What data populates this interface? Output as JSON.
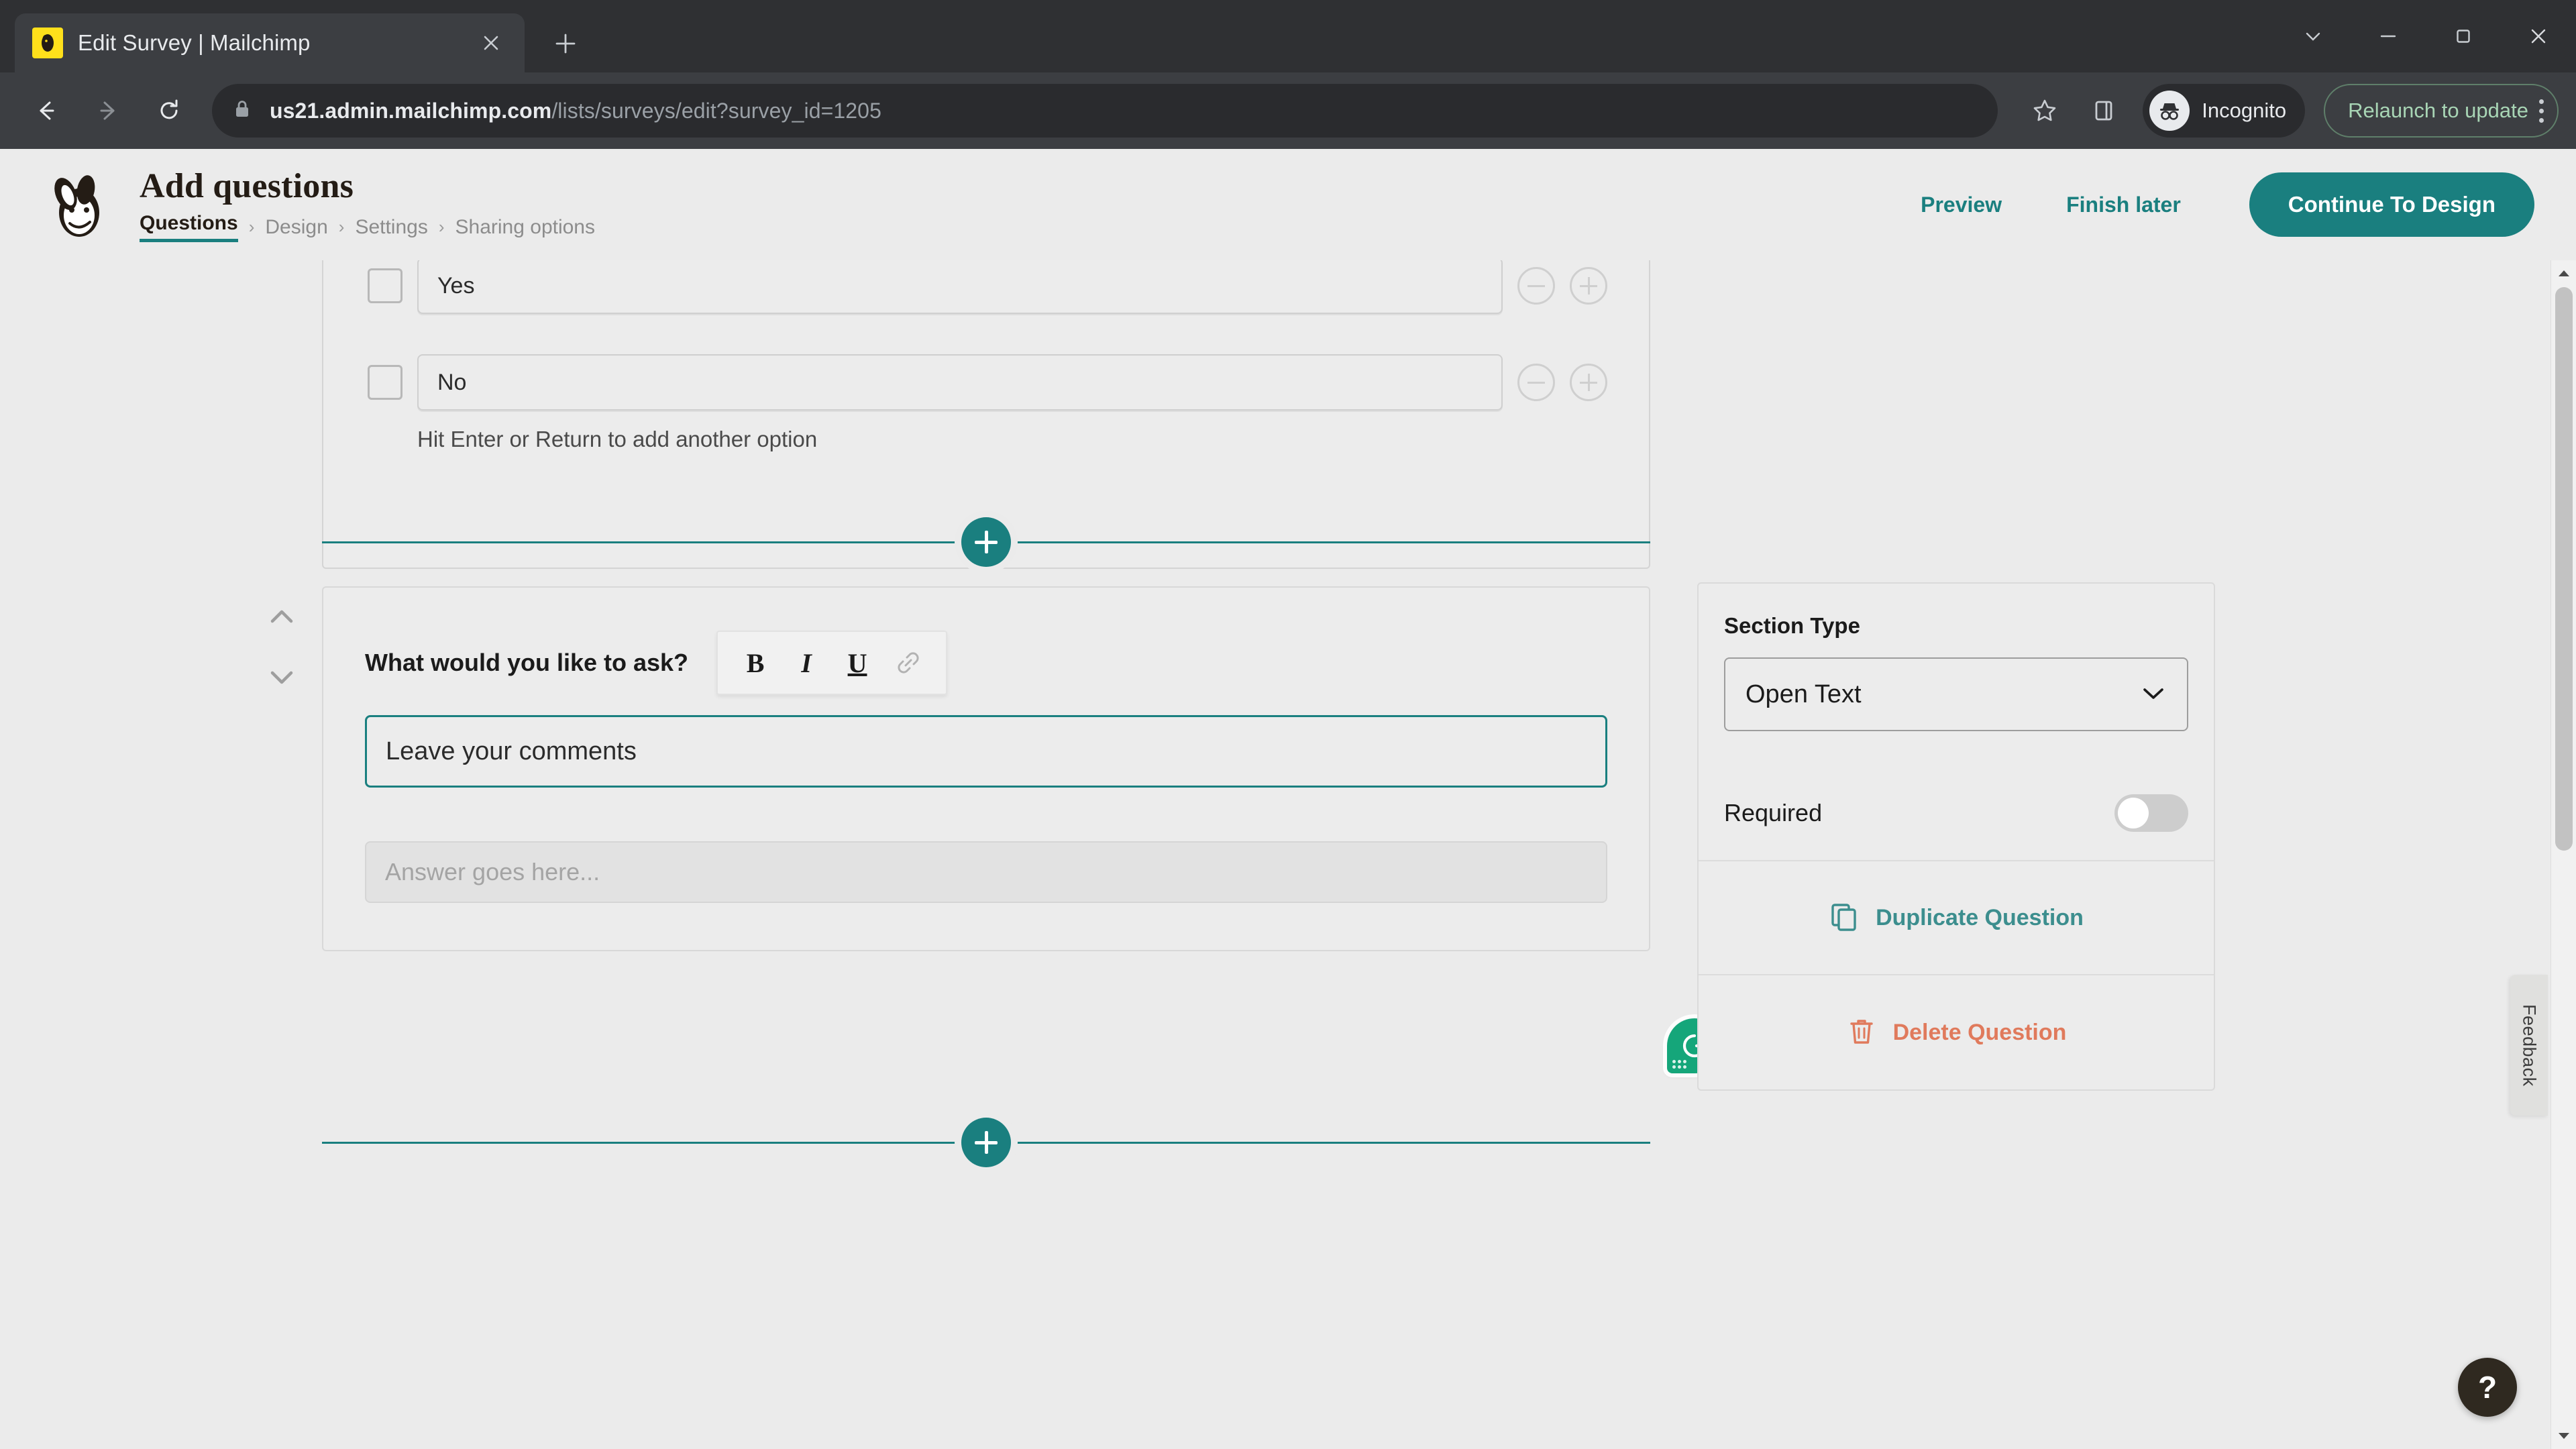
{
  "browser": {
    "tab": {
      "title": "Edit Survey | Mailchimp",
      "favicon": "mailchimp-favicon",
      "close_icon": "close-icon"
    },
    "new_tab_icon": "plus-icon",
    "window": {
      "minimize_icon": "chevron-down-icon",
      "dash_icon": "minimize-icon",
      "maximize_icon": "maximize-icon",
      "close_icon": "close-icon"
    },
    "nav": {
      "back_icon": "back-arrow-icon",
      "forward_icon": "forward-arrow-icon",
      "reload_icon": "reload-icon"
    },
    "omnibox": {
      "lock_icon": "lock-icon",
      "url_domain": "us21.admin.mailchimp.com",
      "url_path": "/lists/surveys/edit?survey_id=1205"
    },
    "bookmark_icon": "star-icon",
    "side_panel_icon": "side-panel-icon",
    "profile": {
      "label": "Incognito",
      "icon": "incognito-icon"
    },
    "update": {
      "label": "Relaunch to update",
      "menu_icon": "kebab-menu-icon"
    }
  },
  "app": {
    "logo": "mailchimp-freddie-logo",
    "title": "Add questions",
    "breadcrumb": [
      {
        "label": "Questions",
        "active": true
      },
      {
        "label": "Design",
        "active": false
      },
      {
        "label": "Settings",
        "active": false
      },
      {
        "label": "Sharing options",
        "active": false
      }
    ],
    "breadcrumb_separator": "›",
    "actions": {
      "preview": "Preview",
      "finish_later": "Finish later",
      "continue": "Continue To Design"
    },
    "accent_color": "#1a7f7f"
  },
  "options_card": {
    "options": [
      {
        "value": "Yes",
        "checkbox": "unchecked",
        "remove_icon": "minus-circle-icon",
        "add_icon": "plus-circle-icon"
      },
      {
        "value": "No",
        "checkbox": "unchecked",
        "remove_icon": "minus-circle-icon",
        "add_icon": "plus-circle-icon"
      }
    ],
    "hint": "Hit Enter or Return to add another option"
  },
  "dividers": {
    "add_icon": "plus-icon",
    "add_label": "Add question"
  },
  "question_card": {
    "reorder": {
      "up_icon": "chevron-up-icon",
      "down_icon": "chevron-down-icon"
    },
    "label": "What would you like to ask?",
    "toolbar": [
      {
        "id": "bold",
        "glyph": "B",
        "icon": "bold-icon"
      },
      {
        "id": "italic",
        "glyph": "I",
        "icon": "italic-icon"
      },
      {
        "id": "underline",
        "glyph": "U",
        "icon": "underline-icon"
      },
      {
        "id": "link",
        "glyph": "",
        "icon": "link-icon"
      }
    ],
    "question_value": "Leave your comments",
    "answer_placeholder": "Answer goes here...",
    "grammarly": {
      "icon": "grammarly-icon",
      "color": "#15a67a"
    }
  },
  "side_panel": {
    "section_type_label": "Section Type",
    "section_type_value": "Open Text",
    "section_type_chevron": "chevron-down-icon",
    "required_label": "Required",
    "required_on": false,
    "duplicate": {
      "label": "Duplicate Question",
      "icon": "duplicate-icon",
      "color": "#3c8e8e"
    },
    "delete": {
      "label": "Delete Question",
      "icon": "trash-icon",
      "color": "#e07a5c"
    }
  },
  "feedback_tab": {
    "label": "Feedback"
  },
  "help": {
    "glyph": "?",
    "icon": "help-icon"
  },
  "scrollbar": {
    "up_icon": "scroll-up-icon",
    "down_icon": "scroll-down-icon"
  }
}
